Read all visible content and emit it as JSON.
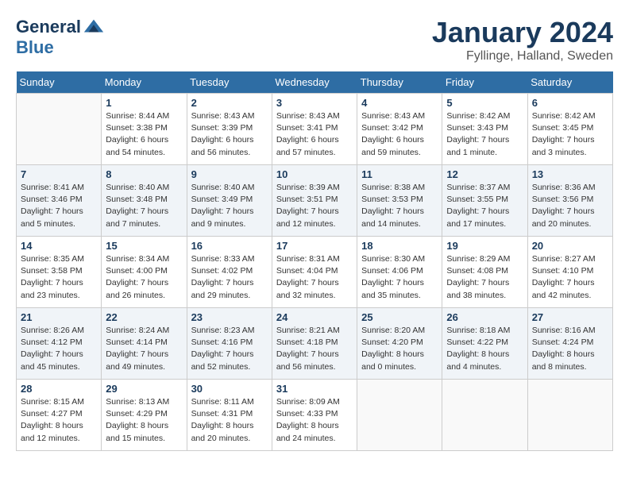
{
  "header": {
    "logo_line1": "General",
    "logo_line2": "Blue",
    "month": "January 2024",
    "location": "Fyllinge, Halland, Sweden"
  },
  "weekdays": [
    "Sunday",
    "Monday",
    "Tuesday",
    "Wednesday",
    "Thursday",
    "Friday",
    "Saturday"
  ],
  "weeks": [
    [
      {
        "day": "",
        "info": ""
      },
      {
        "day": "1",
        "info": "Sunrise: 8:44 AM\nSunset: 3:38 PM\nDaylight: 6 hours\nand 54 minutes."
      },
      {
        "day": "2",
        "info": "Sunrise: 8:43 AM\nSunset: 3:39 PM\nDaylight: 6 hours\nand 56 minutes."
      },
      {
        "day": "3",
        "info": "Sunrise: 8:43 AM\nSunset: 3:41 PM\nDaylight: 6 hours\nand 57 minutes."
      },
      {
        "day": "4",
        "info": "Sunrise: 8:43 AM\nSunset: 3:42 PM\nDaylight: 6 hours\nand 59 minutes."
      },
      {
        "day": "5",
        "info": "Sunrise: 8:42 AM\nSunset: 3:43 PM\nDaylight: 7 hours\nand 1 minute."
      },
      {
        "day": "6",
        "info": "Sunrise: 8:42 AM\nSunset: 3:45 PM\nDaylight: 7 hours\nand 3 minutes."
      }
    ],
    [
      {
        "day": "7",
        "info": "Sunrise: 8:41 AM\nSunset: 3:46 PM\nDaylight: 7 hours\nand 5 minutes."
      },
      {
        "day": "8",
        "info": "Sunrise: 8:40 AM\nSunset: 3:48 PM\nDaylight: 7 hours\nand 7 minutes."
      },
      {
        "day": "9",
        "info": "Sunrise: 8:40 AM\nSunset: 3:49 PM\nDaylight: 7 hours\nand 9 minutes."
      },
      {
        "day": "10",
        "info": "Sunrise: 8:39 AM\nSunset: 3:51 PM\nDaylight: 7 hours\nand 12 minutes."
      },
      {
        "day": "11",
        "info": "Sunrise: 8:38 AM\nSunset: 3:53 PM\nDaylight: 7 hours\nand 14 minutes."
      },
      {
        "day": "12",
        "info": "Sunrise: 8:37 AM\nSunset: 3:55 PM\nDaylight: 7 hours\nand 17 minutes."
      },
      {
        "day": "13",
        "info": "Sunrise: 8:36 AM\nSunset: 3:56 PM\nDaylight: 7 hours\nand 20 minutes."
      }
    ],
    [
      {
        "day": "14",
        "info": "Sunrise: 8:35 AM\nSunset: 3:58 PM\nDaylight: 7 hours\nand 23 minutes."
      },
      {
        "day": "15",
        "info": "Sunrise: 8:34 AM\nSunset: 4:00 PM\nDaylight: 7 hours\nand 26 minutes."
      },
      {
        "day": "16",
        "info": "Sunrise: 8:33 AM\nSunset: 4:02 PM\nDaylight: 7 hours\nand 29 minutes."
      },
      {
        "day": "17",
        "info": "Sunrise: 8:31 AM\nSunset: 4:04 PM\nDaylight: 7 hours\nand 32 minutes."
      },
      {
        "day": "18",
        "info": "Sunrise: 8:30 AM\nSunset: 4:06 PM\nDaylight: 7 hours\nand 35 minutes."
      },
      {
        "day": "19",
        "info": "Sunrise: 8:29 AM\nSunset: 4:08 PM\nDaylight: 7 hours\nand 38 minutes."
      },
      {
        "day": "20",
        "info": "Sunrise: 8:27 AM\nSunset: 4:10 PM\nDaylight: 7 hours\nand 42 minutes."
      }
    ],
    [
      {
        "day": "21",
        "info": "Sunrise: 8:26 AM\nSunset: 4:12 PM\nDaylight: 7 hours\nand 45 minutes."
      },
      {
        "day": "22",
        "info": "Sunrise: 8:24 AM\nSunset: 4:14 PM\nDaylight: 7 hours\nand 49 minutes."
      },
      {
        "day": "23",
        "info": "Sunrise: 8:23 AM\nSunset: 4:16 PM\nDaylight: 7 hours\nand 52 minutes."
      },
      {
        "day": "24",
        "info": "Sunrise: 8:21 AM\nSunset: 4:18 PM\nDaylight: 7 hours\nand 56 minutes."
      },
      {
        "day": "25",
        "info": "Sunrise: 8:20 AM\nSunset: 4:20 PM\nDaylight: 8 hours\nand 0 minutes."
      },
      {
        "day": "26",
        "info": "Sunrise: 8:18 AM\nSunset: 4:22 PM\nDaylight: 8 hours\nand 4 minutes."
      },
      {
        "day": "27",
        "info": "Sunrise: 8:16 AM\nSunset: 4:24 PM\nDaylight: 8 hours\nand 8 minutes."
      }
    ],
    [
      {
        "day": "28",
        "info": "Sunrise: 8:15 AM\nSunset: 4:27 PM\nDaylight: 8 hours\nand 12 minutes."
      },
      {
        "day": "29",
        "info": "Sunrise: 8:13 AM\nSunset: 4:29 PM\nDaylight: 8 hours\nand 15 minutes."
      },
      {
        "day": "30",
        "info": "Sunrise: 8:11 AM\nSunset: 4:31 PM\nDaylight: 8 hours\nand 20 minutes."
      },
      {
        "day": "31",
        "info": "Sunrise: 8:09 AM\nSunset: 4:33 PM\nDaylight: 8 hours\nand 24 minutes."
      },
      {
        "day": "",
        "info": ""
      },
      {
        "day": "",
        "info": ""
      },
      {
        "day": "",
        "info": ""
      }
    ]
  ]
}
